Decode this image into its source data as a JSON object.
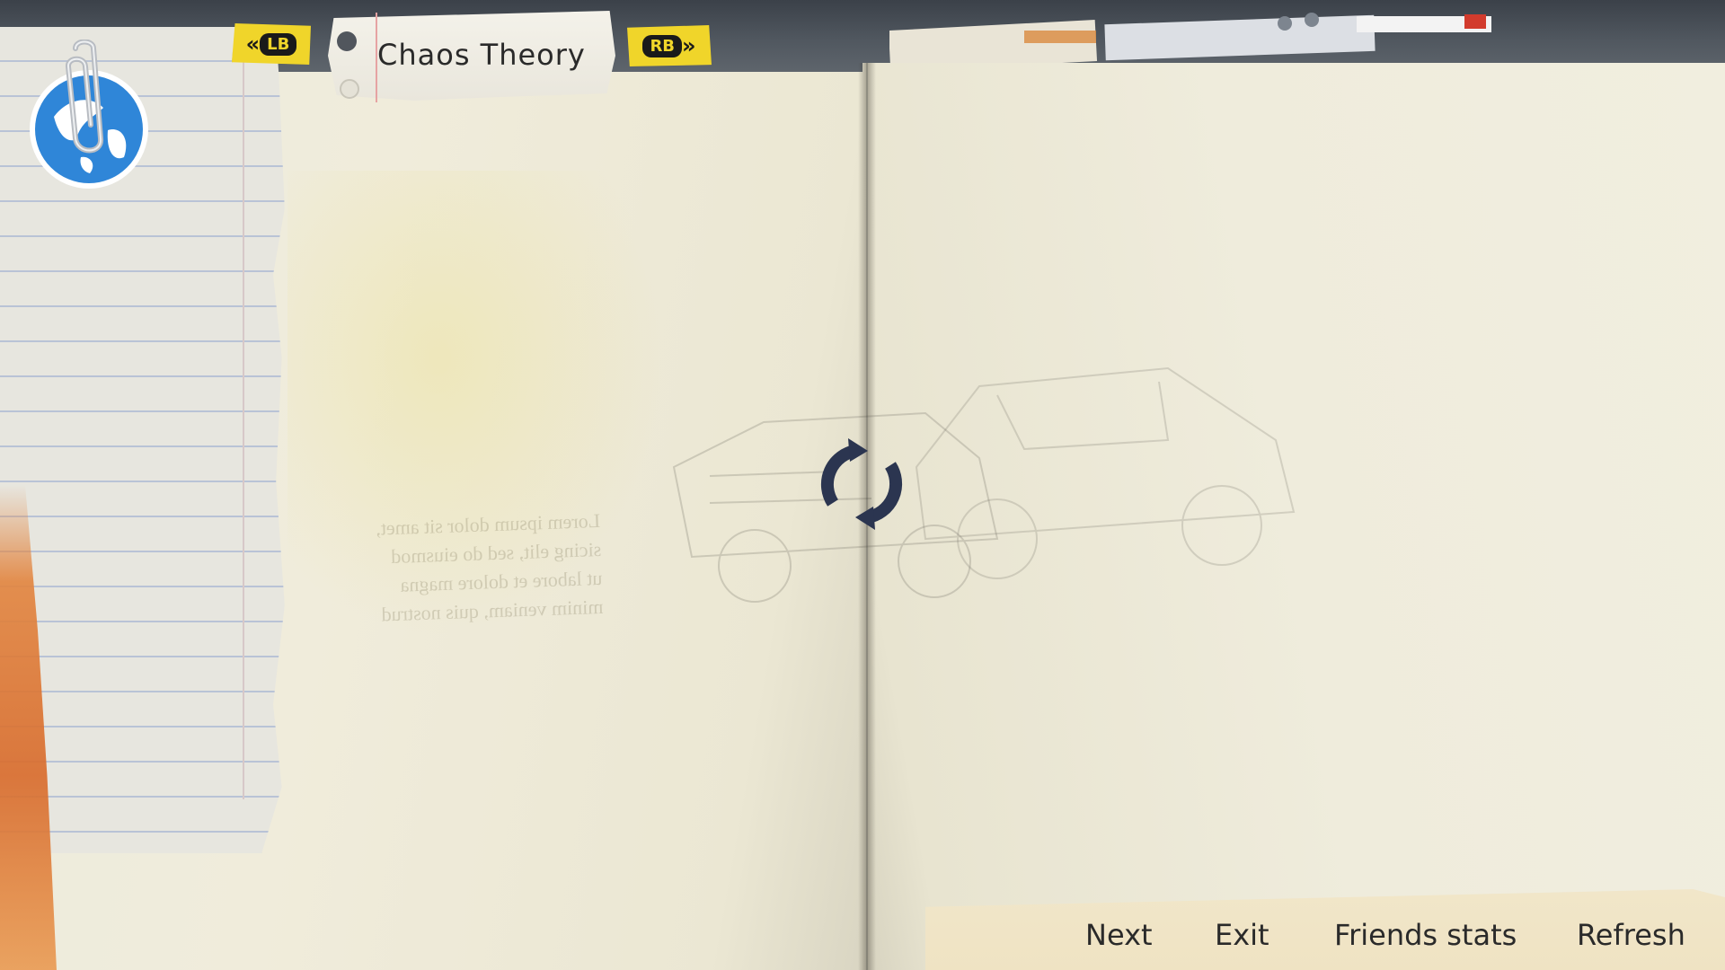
{
  "header": {
    "title": "Chaos Theory",
    "prev_button_label": "LB",
    "next_button_label": "RB"
  },
  "footer": {
    "next_label": "Next",
    "exit_label": "Exit",
    "friends_stats_label": "Friends stats",
    "refresh_label": "Refresh"
  },
  "background_text": {
    "lines": [
      "Lorem ipsum dolor sit amet,",
      "sicing elit, sed do eiusmod",
      "ut labore et dolore magna",
      "minim veniam, quis nostrud"
    ]
  },
  "icons": {
    "globe": "globe-icon",
    "paperclip": "paperclip-icon",
    "loading": "loading-spinner-icon",
    "lb_arrow": "double-chevron-left-icon",
    "rb_arrow": "double-chevron-right-icon"
  },
  "colors": {
    "button_yellow": "#f0d52a",
    "globe_blue": "#2f86d8",
    "paper": "#efecdc",
    "ink": "#2a2a2a",
    "spinner": "#2b3550"
  }
}
